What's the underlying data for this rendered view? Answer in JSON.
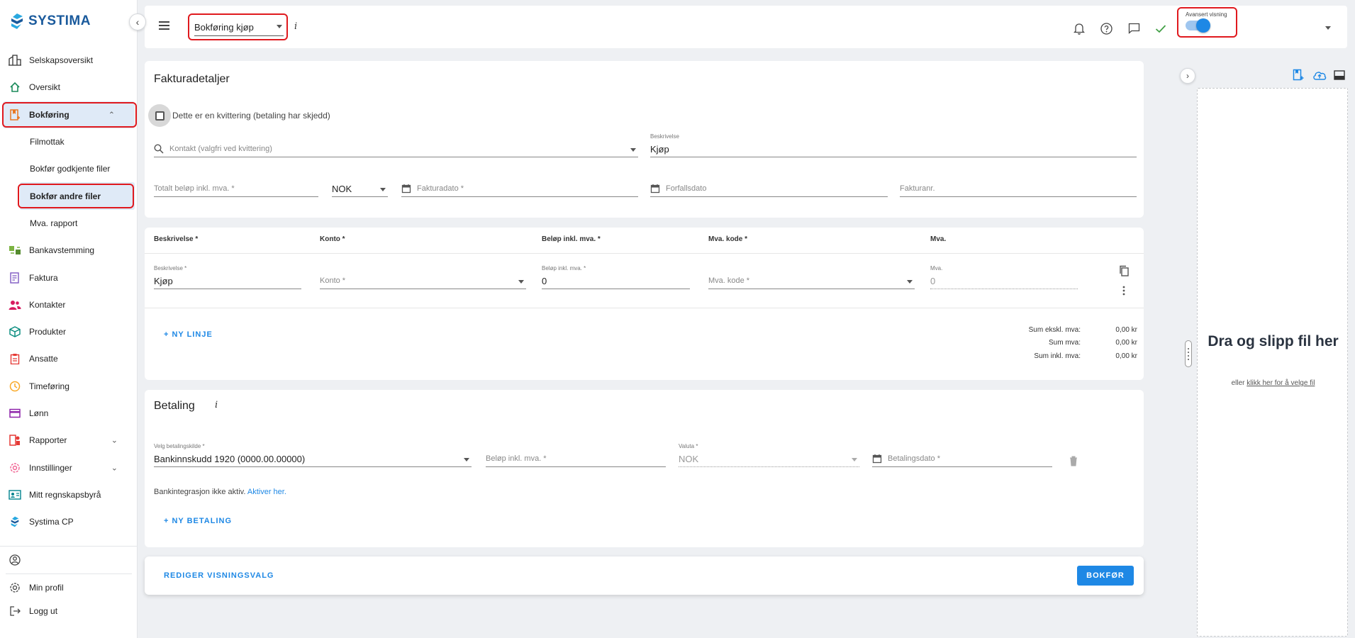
{
  "brand": {
    "name": "SYSTIMA",
    "color": "#1a5a9c"
  },
  "sidebar": {
    "items": [
      {
        "label": "Selskapsoversikt",
        "icon": "building-icon"
      },
      {
        "label": "Oversikt",
        "icon": "home-icon"
      },
      {
        "label": "Bokføring",
        "icon": "bookkeeping-icon",
        "expanded": true
      },
      {
        "label": "Filmottak",
        "sub": true
      },
      {
        "label": "Bokfør godkjente filer",
        "sub": true
      },
      {
        "label": "Bokfør andre filer",
        "sub": true,
        "active": true
      },
      {
        "label": "Mva. rapport",
        "sub": true
      },
      {
        "label": "Bankavstemming",
        "icon": "bank-reconcile-icon"
      },
      {
        "label": "Faktura",
        "icon": "invoice-icon"
      },
      {
        "label": "Kontakter",
        "icon": "contacts-icon"
      },
      {
        "label": "Produkter",
        "icon": "cube-icon"
      },
      {
        "label": "Ansatte",
        "icon": "clipboard-icon"
      },
      {
        "label": "Timeføring",
        "icon": "clock-icon"
      },
      {
        "label": "Lønn",
        "icon": "card-icon"
      },
      {
        "label": "Rapporter",
        "icon": "report-icon",
        "chevron": true
      },
      {
        "label": "Innstillinger",
        "icon": "settings-icon",
        "chevron": true
      },
      {
        "label": "Mitt regnskapsbyrå",
        "icon": "idcard-icon"
      },
      {
        "label": "Systima CP",
        "icon": "systima-icon"
      }
    ],
    "bottom": [
      {
        "label": "Min profil",
        "icon": "gear-icon"
      },
      {
        "label": "Logg ut",
        "icon": "logout-icon"
      }
    ]
  },
  "topbar": {
    "mode_value": "Bokføring kjøp",
    "info": "i",
    "toggle_label": "Avansert visning",
    "toggle_on": true
  },
  "invoice": {
    "title": "Fakturadetaljer",
    "receipt_checkbox": "Dette er en kvittering (betaling har skjedd)",
    "contact_placeholder": "Kontakt (valgfri ved kvittering)",
    "description_label": "Beskrivelse",
    "description_value": "Kjøp",
    "total_placeholder": "Totalt beløp inkl. mva. *",
    "currency": "NOK",
    "invoice_date_placeholder": "Fakturadato *",
    "due_date_placeholder": "Forfallsdato",
    "invoice_no_placeholder": "Fakturanr."
  },
  "lines": {
    "headers": [
      "Beskrivelse *",
      "Konto *",
      "Beløp inkl. mva. *",
      "Mva. kode *",
      "Mva."
    ],
    "row": {
      "desc_label": "Beskrivelse *",
      "desc_value": "Kjøp",
      "account_placeholder": "Konto *",
      "amount_label": "Beløp inkl. mva. *",
      "amount_value": "0",
      "vat_code_placeholder": "Mva. kode *",
      "vat_label": "Mva.",
      "vat_value": "0"
    },
    "new_line": "+ NY LINJE",
    "sums": [
      {
        "label": "Sum ekskl. mva:",
        "value": "0,00 kr"
      },
      {
        "label": "Sum mva:",
        "value": "0,00 kr"
      },
      {
        "label": "Sum inkl. mva:",
        "value": "0,00 kr"
      }
    ]
  },
  "payment": {
    "title": "Betaling",
    "source_label": "Velg betalingskilde *",
    "source_value": "Bankinnskudd 1920 (0000.00.00000)",
    "amount_placeholder": "Beløp inkl. mva. *",
    "currency_label": "Valuta *",
    "currency_value": "NOK",
    "date_placeholder": "Betalingsdato *",
    "bank_notice": "Bankintegrasjon ikke aktiv.",
    "bank_link": "Aktiver her.",
    "new_payment": "+ NY BETALING"
  },
  "footer": {
    "edit_view": "REDIGER VISNINGSVALG",
    "submit": "BOKFØR"
  },
  "dropzone": {
    "title": "Dra og slipp fil her",
    "sub_prefix": "eller",
    "sub_link": "klikk her for å velge fil"
  },
  "colors": {
    "accent": "#1e88e5",
    "highlight": "#e0191e",
    "active_bg": "#dfeaf7"
  }
}
